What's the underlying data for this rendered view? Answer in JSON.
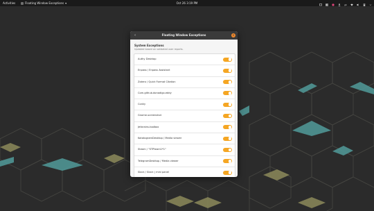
{
  "topbar": {
    "activities": "Activities",
    "app_menu": "Floating Window Exceptions",
    "app_menu_arrow": "▾",
    "clock": "Oct 26  3:19 PM"
  },
  "dialog": {
    "title": "Floating Window Exceptions",
    "back_glyph": "‹",
    "close_glyph": "✕",
    "section_title": "System Exceptions",
    "section_subtitle": "Updated based on validated user reports.",
    "items": [
      {
        "label": "Authy Desktop",
        "enabled": true
      },
      {
        "label": "Enpass / Enpass Assistant",
        "enabled": true
      },
      {
        "label": "Zotero / Quick Format Citation",
        "enabled": true
      },
      {
        "label": "Com.github.donadigo.eddy",
        "enabled": true
      },
      {
        "label": "Conky",
        "enabled": true
      },
      {
        "label": "Gnome-screenshot",
        "enabled": true
      },
      {
        "label": "Jetbrains-toolbox",
        "enabled": true
      },
      {
        "label": "KotatogramDesktop / Media viewer",
        "enabled": true
      },
      {
        "label": "Steam / \"STPteam1*1\"",
        "enabled": true
      },
      {
        "label": "TelegramDesktop / Media viewer",
        "enabled": true
      },
      {
        "label": "Slack / Slack | mini panel",
        "enabled": true
      }
    ]
  },
  "colors": {
    "accent": "#f5a623",
    "close": "#f28a2c",
    "topbar": "#1a1a1a",
    "header": "#3a3a3a",
    "wallpaper": "#2c2c2c",
    "hex_teal": "#4f9594",
    "hex_olive": "#8c8a5b"
  }
}
